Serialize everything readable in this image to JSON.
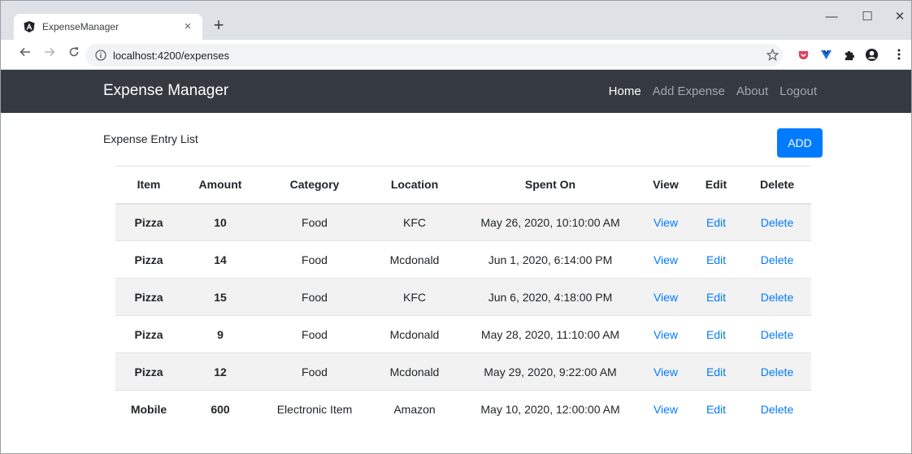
{
  "browser": {
    "tab_title": "ExpenseManager",
    "tab_close": "×",
    "new_tab": "+",
    "url": "localhost:4200/expenses",
    "window_controls": {
      "minimize": "—",
      "maximize": "☐",
      "close": "✕"
    }
  },
  "navbar": {
    "brand": "Expense Manager",
    "links": [
      {
        "label": "Home",
        "active": true
      },
      {
        "label": "Add Expense",
        "active": false
      },
      {
        "label": "About",
        "active": false
      },
      {
        "label": "Logout",
        "active": false
      }
    ]
  },
  "main": {
    "title": "Expense Entry List",
    "add_label": "ADD",
    "columns": [
      "Item",
      "Amount",
      "Category",
      "Location",
      "Spent On",
      "View",
      "Edit",
      "Delete"
    ],
    "rows": [
      {
        "item": "Pizza",
        "amount": "10",
        "category": "Food",
        "location": "KFC",
        "spent_on": "May 26, 2020, 10:10:00 AM",
        "view": "View",
        "edit": "Edit",
        "delete": "Delete"
      },
      {
        "item": "Pizza",
        "amount": "14",
        "category": "Food",
        "location": "Mcdonald",
        "spent_on": "Jun 1, 2020, 6:14:00 PM",
        "view": "View",
        "edit": "Edit",
        "delete": "Delete"
      },
      {
        "item": "Pizza",
        "amount": "15",
        "category": "Food",
        "location": "KFC",
        "spent_on": "Jun 6, 2020, 4:18:00 PM",
        "view": "View",
        "edit": "Edit",
        "delete": "Delete"
      },
      {
        "item": "Pizza",
        "amount": "9",
        "category": "Food",
        "location": "Mcdonald",
        "spent_on": "May 28, 2020, 11:10:00 AM",
        "view": "View",
        "edit": "Edit",
        "delete": "Delete"
      },
      {
        "item": "Pizza",
        "amount": "12",
        "category": "Food",
        "location": "Mcdonald",
        "spent_on": "May 29, 2020, 9:22:00 AM",
        "view": "View",
        "edit": "Edit",
        "delete": "Delete"
      },
      {
        "item": "Mobile",
        "amount": "600",
        "category": "Electronic Item",
        "location": "Amazon",
        "spent_on": "May 10, 2020, 12:00:00 AM",
        "view": "View",
        "edit": "Edit",
        "delete": "Delete"
      }
    ]
  },
  "colors": {
    "navbar": "#343a40",
    "primary": "#007bff",
    "stripe": "#f2f2f2"
  },
  "icons": [
    "angular-logo-icon",
    "info-icon",
    "star-icon",
    "pocket-icon",
    "vue-devtools-icon",
    "puzzle-extension-icon",
    "profile-icon",
    "more-icon"
  ]
}
